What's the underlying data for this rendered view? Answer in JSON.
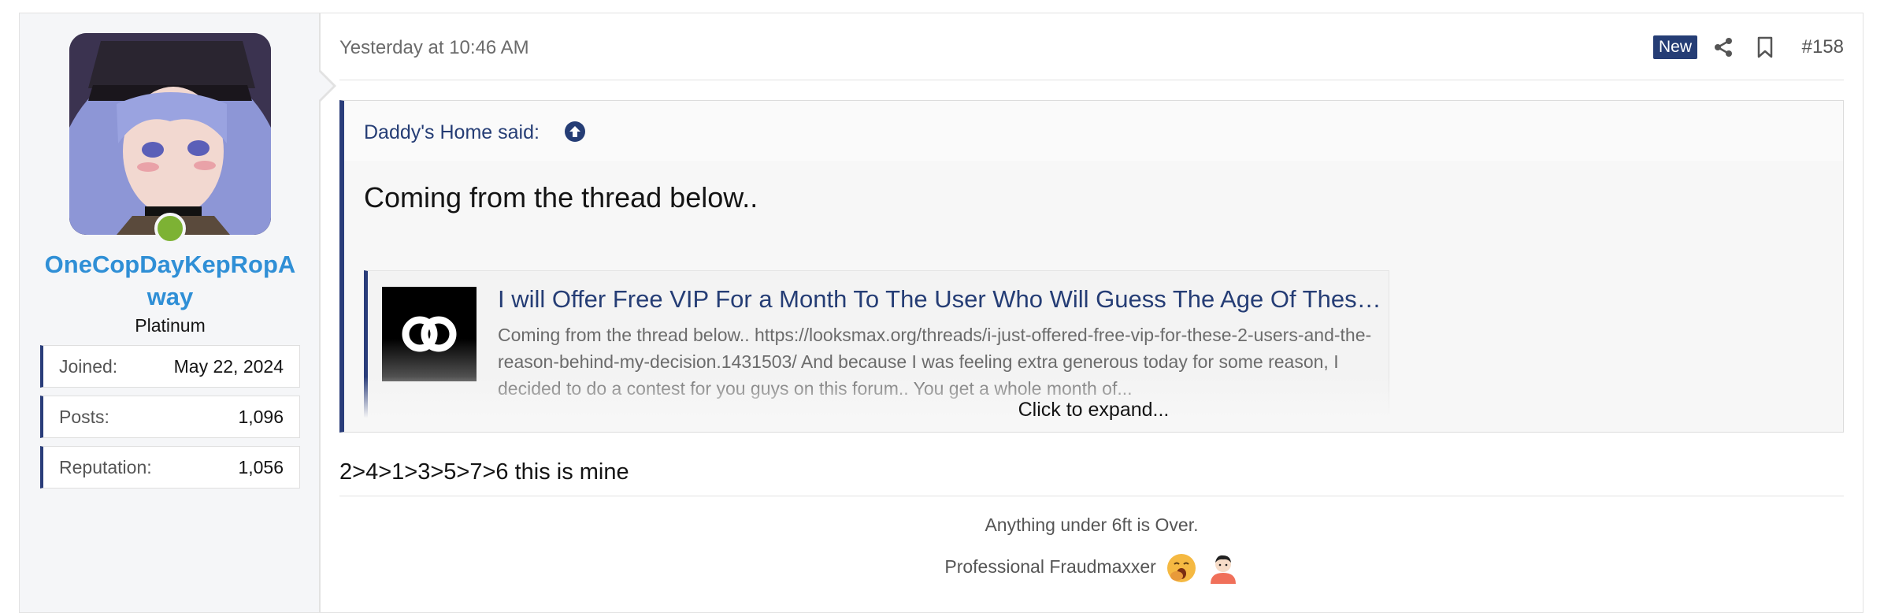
{
  "post": {
    "date": "Yesterday at 10:46 AM",
    "badge": "New",
    "number": "#158",
    "body": "2>4>1>3>5>7>6 this is mine"
  },
  "user": {
    "name": "OneCopDayKepRopAway",
    "title": "Platinum",
    "stats": [
      {
        "label": "Joined:",
        "value": "May 22, 2024"
      },
      {
        "label": "Posts:",
        "value": "1,096"
      },
      {
        "label": "Reputation:",
        "value": "1,056"
      }
    ]
  },
  "quote": {
    "author": "Daddy's Home said:",
    "text": "Coming from the thread below..",
    "unfurl_title": "I will Offer Free VIP For a Month To The User Who Will Guess The Age Of These Users",
    "unfurl_desc": "Coming from the thread below.. https://looksmax.org/threads/i-just-offered-free-vip-for-these-2-users-and-the-reason-behind-my-decision.1431503/ And because I was feeling extra generous today for some reason, I decided to do a contest for you guys on this forum.. You get a whole month of...",
    "expand": "Click to expand..."
  },
  "signature": {
    "line1": "Anything under 6ft is Over.",
    "line2": "Professional Fraudmaxxer"
  },
  "icons": [
    "share-icon",
    "bookmark-icon",
    "arrow-up-circle-icon",
    "yawning-face-icon",
    "person-icon"
  ],
  "colors": {
    "accent": "#253d75",
    "username": "#2f8fd6",
    "online": "#7db234"
  }
}
